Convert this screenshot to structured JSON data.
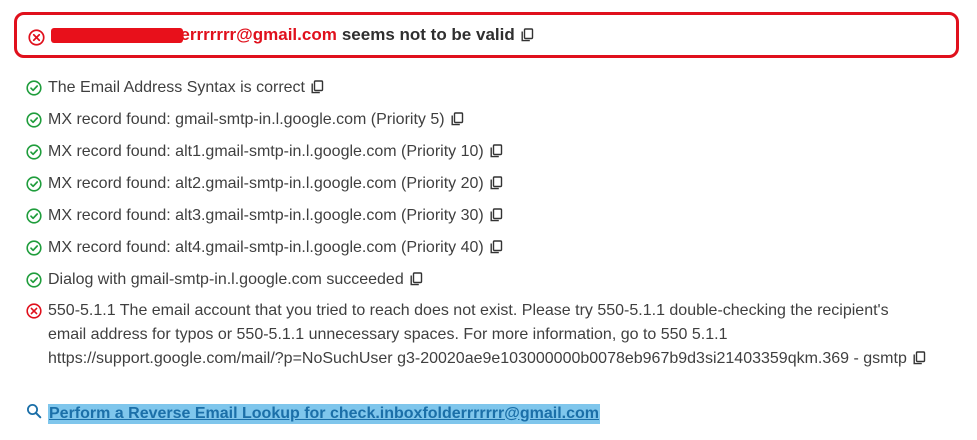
{
  "result": {
    "email": "check.inboxfolderrrrrrr@gmail.com",
    "verdict": "seems not to be valid",
    "status_color": "#e0101c"
  },
  "checks": [
    {
      "status": "ok",
      "text": "The Email Address Syntax is correct"
    },
    {
      "status": "ok",
      "text": "MX record found: gmail-smtp-in.l.google.com (Priority 5)"
    },
    {
      "status": "ok",
      "text": "MX record found: alt1.gmail-smtp-in.l.google.com (Priority 10)"
    },
    {
      "status": "ok",
      "text": "MX record found: alt2.gmail-smtp-in.l.google.com (Priority 20)"
    },
    {
      "status": "ok",
      "text": "MX record found: alt3.gmail-smtp-in.l.google.com (Priority 30)"
    },
    {
      "status": "ok",
      "text": "MX record found: alt4.gmail-smtp-in.l.google.com (Priority 40)"
    },
    {
      "status": "ok",
      "text": "Dialog with gmail-smtp-in.l.google.com succeeded"
    },
    {
      "status": "error",
      "text": "550-5.1.1 The email account that you tried to reach does not exist. Please try 550-5.1.1 double-checking the recipient's email address for typos or 550-5.1.1 unnecessary spaces. For more information, go to 550 5.1.1 https://support.google.com/mail/?p=NoSuchUser g3-20020ae9e103000000b0078eb967b9d3si21403359qkm.369 - gsmtp"
    }
  ],
  "lookup": {
    "label": "Perform a Reverse Email Lookup for check.inboxfolderrrrrrr@gmail.com"
  },
  "icons": {
    "ok": "check-circle-icon",
    "error": "x-circle-icon",
    "copy": "copy-icon",
    "search": "search-icon"
  },
  "colors": {
    "ok": "#1f9d3c",
    "error": "#e0101c",
    "link": "#1b6fa8",
    "link_highlight": "#7fc6ec"
  }
}
